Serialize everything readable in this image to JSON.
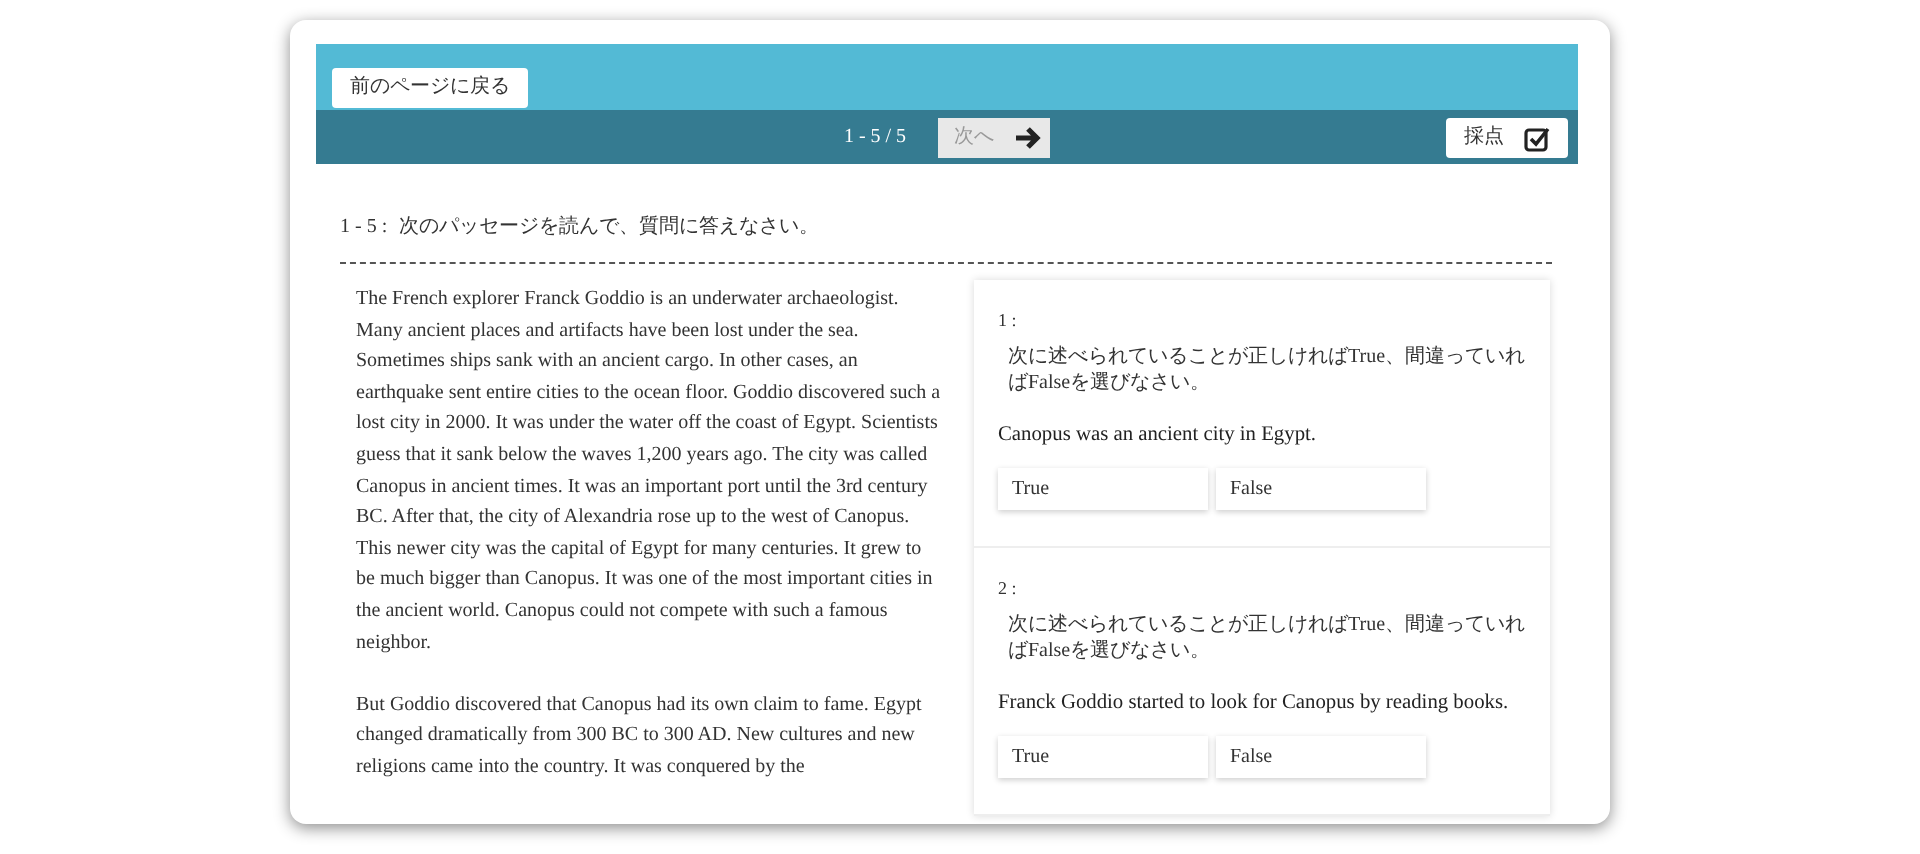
{
  "back_button": "前のページに戻る",
  "pagination": {
    "range": "1 - 5 / 5",
    "next_button": {
      "label": "次へ",
      "disabled": true
    }
  },
  "grade_button": "採点",
  "instruction": {
    "number": "1 - 5 :",
    "text": "次のパッセージを読んで、質問に答えなさい。"
  },
  "passage": [
    "The French explorer Franck Goddio is an underwater archaeologist. Many ancient places and artifacts have been lost under the sea. Sometimes ships sank with an ancient cargo. In other cases, an earthquake sent entire cities to the ocean floor. Goddio discovered such a lost city in 2000. It was under the water off the coast of Egypt. Scientists guess that it sank below the waves 1,200 years ago. The city was called Canopus in ancient times. It was an important port until the 3rd century BC. After that, the city of Alexandria rose up to the west of Canopus. This newer city was the capital of Egypt for many centuries. It grew to be much bigger than Canopus. It was one of the most important cities in the ancient world. Canopus could not compete with such a famous neighbor.",
    "But Goddio discovered that Canopus had its own claim to fame. Egypt changed dramatically from 300 BC to 300 AD. New cultures and new religions came into the country. It was conquered by the"
  ],
  "questions": [
    {
      "number": "1 :",
      "instruction": "次に述べられていることが正しければTrue、間違っていればFalseを選びなさい。",
      "statement": "Canopus was an ancient city in Egypt.",
      "options": [
        {
          "label": "True",
          "selected": false
        },
        {
          "label": "False",
          "selected": false
        }
      ]
    },
    {
      "number": "2 :",
      "instruction": "次に述べられていることが正しければTrue、間違っていればFalseを選びなさい。",
      "statement": "Franck Goddio started to look for Canopus by reading books.",
      "options": [
        {
          "label": "True",
          "selected": false
        },
        {
          "label": "False",
          "selected": false
        }
      ]
    }
  ]
}
